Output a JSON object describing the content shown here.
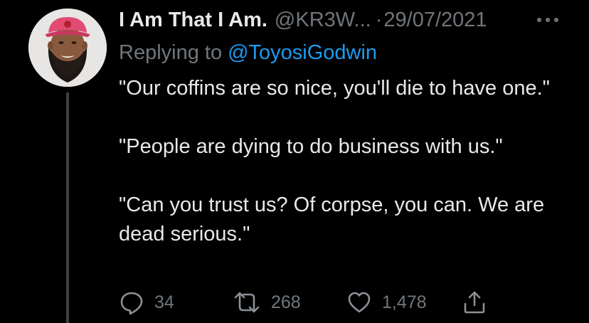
{
  "tweet": {
    "display_name": "I Am That I Am.",
    "handle": "@KR3W...",
    "separator": "·",
    "date": "29/07/2021",
    "reply_prefix": "Replying to",
    "reply_handle": "@ToyosiGodwin",
    "paragraphs": [
      "\"Our coffins are so nice, you'll die to have one.\"",
      "\"People are dying to do business with us.\"",
      "\"Can you trust us? Of corpse, you can. We are dead serious.\""
    ],
    "metrics": {
      "replies": "34",
      "retweets": "268",
      "likes": "1,478"
    }
  },
  "icons": {
    "more": "ellipsis-icon",
    "reply": "reply-bubble-icon",
    "retweet": "retweet-icon",
    "like": "heart-icon",
    "share": "share-icon"
  },
  "colors": {
    "background": "#000000",
    "text_primary": "#e7e9ea",
    "text_secondary": "#71767b",
    "link": "#1d9bf0",
    "thread_line": "#3d4145"
  }
}
